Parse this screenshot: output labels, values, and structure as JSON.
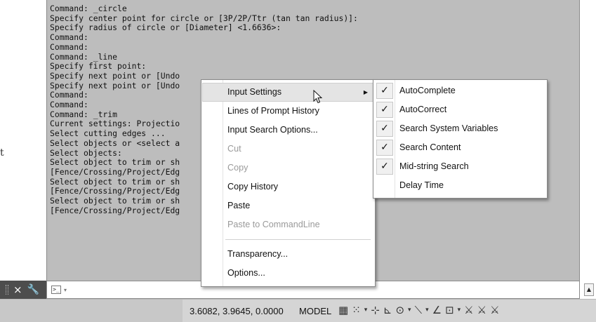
{
  "history_lines": [
    "Command: _circle",
    "Specify center point for circle or [3P/2P/Ttr (tan tan radius)]:",
    "Specify radius of circle or [Diameter] <1.6636>:",
    "Command:",
    "Command:",
    "Command: _line",
    "Specify first point:",
    "Specify next point or [Undo",
    "Specify next point or [Undo",
    "Command:",
    "Command:",
    "Command: _trim",
    "Current settings: Projectio",
    "Select cutting edges ...",
    "Select objects or <select a",
    "Select objects:",
    "Select object to trim or sh",
    "[Fence/Crossing/Project/Edg",
    "Select object to trim or sh",
    "[Fence/Crossing/Project/Edg",
    "Select object to trim or sh",
    "[Fence/Crossing/Project/Edg"
  ],
  "stray_glyph": "t",
  "cmdbar": {
    "close_glyph": "×",
    "wrench_glyph": "🔧",
    "prompt_glyph": ">_",
    "prompt_dropdown": "▾",
    "scroll_up_glyph": "▲"
  },
  "status": {
    "coords": "3.6082, 3.9645, 0.0000",
    "model": "MODEL",
    "icons": [
      {
        "name": "grid-icon",
        "glyph": "▦"
      },
      {
        "name": "snap-icon",
        "glyph": "⁙"
      },
      {
        "name": "dropdown-arrow",
        "glyph": "▾"
      },
      {
        "name": "infer-constraints-icon",
        "glyph": "⊹"
      },
      {
        "name": "ortho-icon",
        "glyph": "⊾"
      },
      {
        "name": "polar-icon",
        "glyph": "⊙"
      },
      {
        "name": "dropdown-arrow",
        "glyph": "▾"
      },
      {
        "name": "osnap-tracking-icon",
        "glyph": "⟍"
      },
      {
        "name": "dropdown-arrow",
        "glyph": "▾"
      },
      {
        "name": "isodraft-icon",
        "glyph": "∠"
      },
      {
        "name": "object-snap-icon",
        "glyph": "⊡"
      },
      {
        "name": "dropdown-arrow",
        "glyph": "▾"
      },
      {
        "name": "annotation-scale-icon",
        "glyph": "⚔"
      },
      {
        "name": "annotation-visibility-icon",
        "glyph": "⚔"
      },
      {
        "name": "auto-scale-icon",
        "glyph": "⚔"
      }
    ]
  },
  "context_menu": {
    "items": [
      {
        "label": "Input Settings",
        "disabled": false,
        "submenu": true,
        "hover": true
      },
      {
        "label": "Lines of Prompt History",
        "disabled": false
      },
      {
        "label": "Input Search Options...",
        "disabled": false
      },
      {
        "label": "Cut",
        "disabled": true
      },
      {
        "label": "Copy",
        "disabled": true
      },
      {
        "label": "Copy History",
        "disabled": false
      },
      {
        "label": "Paste",
        "disabled": false
      },
      {
        "label": "Paste to CommandLine",
        "disabled": true
      },
      {
        "label": "Transparency...",
        "disabled": false
      },
      {
        "label": "Options...",
        "disabled": false
      }
    ],
    "submenu_arrow": "▶"
  },
  "input_settings_submenu": {
    "items": [
      {
        "label": "AutoComplete",
        "checked": true
      },
      {
        "label": "AutoCorrect",
        "checked": true
      },
      {
        "label": "Search System Variables",
        "checked": true
      },
      {
        "label": "Search Content",
        "checked": true
      },
      {
        "label": "Mid-string Search",
        "checked": true
      },
      {
        "label": "Delay Time",
        "checked": false
      }
    ],
    "check_glyph": "✓"
  }
}
